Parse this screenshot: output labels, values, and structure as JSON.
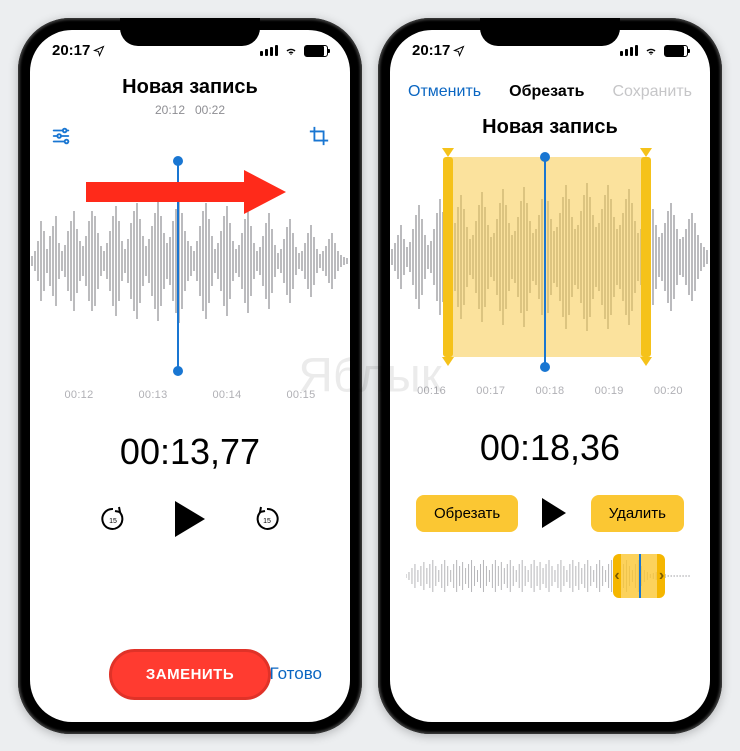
{
  "watermark": "Яблык",
  "left": {
    "status": {
      "time": "20:17"
    },
    "title": "Новая запись",
    "timestamp": "20:12",
    "duration": "00:22",
    "ticks": [
      "00:12",
      "00:13",
      "00:14",
      "00:15"
    ],
    "currentTime": "00:13,77",
    "replace": "ЗАМЕНИТЬ",
    "done": "Готово"
  },
  "right": {
    "status": {
      "time": "20:17"
    },
    "nav": {
      "cancel": "Отменить",
      "title": "Обрезать",
      "save": "Сохранить"
    },
    "title": "Новая запись",
    "ticks": [
      "00:16",
      "00:17",
      "00:18",
      "00:19",
      "00:20"
    ],
    "currentTime": "00:18,36",
    "trim": "Обрезать",
    "delete": "Удалить"
  }
}
